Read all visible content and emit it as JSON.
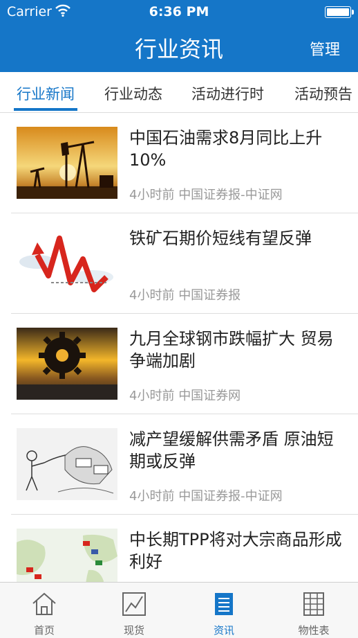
{
  "status_bar": {
    "carrier": "Carrier",
    "time": "6:36 PM"
  },
  "header": {
    "title": "行业资讯",
    "manage_label": "管理"
  },
  "tabs": [
    {
      "label": "行业新闻",
      "active": true
    },
    {
      "label": "行业动态",
      "active": false
    },
    {
      "label": "活动进行时",
      "active": false
    },
    {
      "label": "活动预告",
      "active": false
    }
  ],
  "news": [
    {
      "title": "中国石油需求8月同比上升10%",
      "time": "4小时前",
      "source": "中国证券报-中证网",
      "image": "oil-pumpjack-image"
    },
    {
      "title": "铁矿石期价短线有望反弹",
      "time": "4小时前",
      "source": "中国证券报",
      "image": "red-trend-arrow-image"
    },
    {
      "title": "九月全球钢市跌幅扩大 贸易争端加剧",
      "time": "4小时前",
      "source": "中国证券网",
      "image": "gear-image"
    },
    {
      "title": "减产望缓解供需矛盾 原油短期或反弹",
      "time": "4小时前",
      "source": "中国证券报-中证网",
      "image": "cartoon-image"
    },
    {
      "title": "中长期TPP将对大宗商品形成利好",
      "time": "",
      "source": "",
      "image": "tpp-map-image"
    }
  ],
  "tabbar": [
    {
      "label": "首页",
      "icon": "home-icon",
      "active": false
    },
    {
      "label": "现货",
      "icon": "chart-icon",
      "active": false
    },
    {
      "label": "资讯",
      "icon": "news-icon",
      "active": true
    },
    {
      "label": "物性表",
      "icon": "table-icon",
      "active": false
    }
  ],
  "colors": {
    "primary": "#1576c8",
    "tabbar_bg": "#f7f7f7",
    "meta_text": "#999999"
  }
}
